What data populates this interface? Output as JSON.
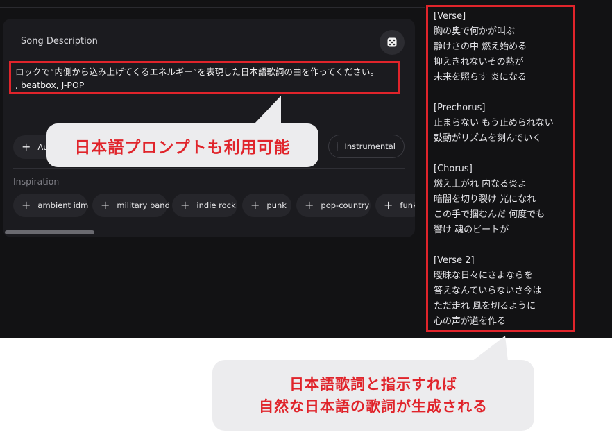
{
  "card": {
    "title": "Song Description",
    "prompt_line1": "ロックで“内側から込み上げてくるエネルギー”を表現した日本語歌詞の曲を作ってください。",
    "prompt_line2": ", beatbox, J-POP",
    "audio_chip": "Au",
    "instrumental_label": "Instrumental",
    "inspiration_label": "Inspiration",
    "inspiration_chips": [
      "ambient idm",
      "military band",
      "indie rock",
      "punk",
      "pop-country",
      "funk"
    ]
  },
  "lyrics": {
    "verse_header": "[Verse]",
    "verse_lines": [
      "胸の奥で何かが叫ぶ",
      "静けさの中 燃え始める",
      "抑えきれないその熱が",
      "未来を照らす 炎になる"
    ],
    "prechorus_header": "[Prechorus]",
    "prechorus_lines": [
      "止まらない もう止められない",
      "鼓動がリズムを刻んでいく"
    ],
    "chorus_header": "[Chorus]",
    "chorus_lines": [
      "燃え上がれ 内なる炎よ",
      "暗闇を切り裂け 光になれ",
      "この手で掴むんだ 何度でも",
      "響け 魂のビートが"
    ],
    "verse2_header": "[Verse 2]",
    "verse2_lines": [
      "曖昧な日々にさよならを",
      "答えなんていらないさ今は",
      "ただ走れ 風を切るように",
      "心の声が道を作る"
    ]
  },
  "callouts": {
    "prompt_note": "日本語プロンプトも利用可能",
    "lyrics_note_line1": "日本語歌詞と指示すれば",
    "lyrics_note_line2": "自然な日本語の歌詞が生成される"
  },
  "colors": {
    "accent_red": "#e0242b",
    "app_bg": "#121214",
    "card_bg": "#1b1b1f",
    "chip_bg": "#26262b",
    "callout_bg": "#ececee"
  }
}
